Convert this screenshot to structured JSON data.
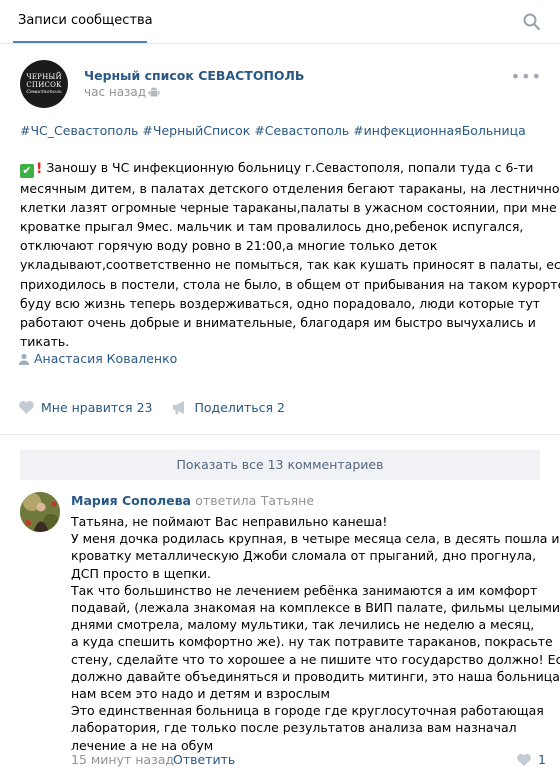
{
  "header": {
    "tab_label": "Записи сообщества",
    "search_icon": "search-icon"
  },
  "post": {
    "author": "Черный список СЕВАСТОПОЛЬ",
    "time": "час назад",
    "avatar_text_1": "ЧЕРНЫЙ",
    "avatar_text_2": "СПИСОК",
    "avatar_text_3": "Севастополь",
    "hashtags": "#ЧС_Севастополь #ЧерныйСписок #Севастополь #инфекционнаяБольница",
    "text_lines": [
      "Заношу в ЧС инфекционную больницу г.Севастополя, попали туда с 6-ти",
      "месячным дитем, в палатах детского отделения бегают тараканы, на лестничной",
      "клетки лазят огромные черные тараканы,палаты в ужасном состоянии, при мне в",
      "кроватке прыгал 9мес. мальчик и там провалилось дно,ребенок испугался,",
      "отключают горячую воду ровно в 21:00,а многие только деток",
      "укладывают,соответственно не помыться, так как кушать приносят в палаты, есть",
      "приходилось в постели, стола не было, в общем от прибывания на таком курорте",
      "буду всю жизнь теперь воздерживаться, одно порадовало, люди которые тут",
      "работают очень добрые и внимательные, благодаря им быстро вычухались и",
      "тикать."
    ],
    "signer": "Анастасия Коваленко",
    "like_label": "Мне нравится",
    "like_count": "23",
    "share_label": "Поделиться",
    "share_count": "2"
  },
  "comments": {
    "show_all_label": "Показать все 13 комментариев",
    "items": [
      {
        "author": "Мария Сополева",
        "reply_word": "ответила",
        "reply_to": "Татьяне",
        "lines": [
          "Татьяна, не поймают Вас неправильно канеша!",
          "У меня дочка родилась крупная, в четыре месяца села, в десять пошла и",
          "кроватку металлическую Джоби сломала от прыганий, дно прогнула,",
          "ДСП просто в щепки.",
          "Так что большинство не лечением ребёнка занимаются а им комфорт",
          "подавай, (лежала знакомая на комплексе в ВИП палате, фильмы целыми",
          "днями смотрела, малому мультики, так лечились не неделю а месяц,",
          "а куда спешить комфортно же). ну так потравите тараканов, покрасьте",
          "стену, сделайте что то хорошее а не пишите что государство должно! Если",
          "должно давайте объединяться и проводить митинги, это наша больница,",
          "нам всем это надо и детям и взрослым",
          "Это единственная больница в городе где круглосуточная работающая",
          "лаборатория, где только после результатов анализа вам назначал",
          "лечение а не на обум"
        ],
        "time": "15 минут назад",
        "answer_label": "Ответить",
        "like_count": "1"
      }
    ]
  },
  "colors": {
    "link": "#2a5885",
    "muted": "#939393",
    "accent": "#5181b8"
  }
}
